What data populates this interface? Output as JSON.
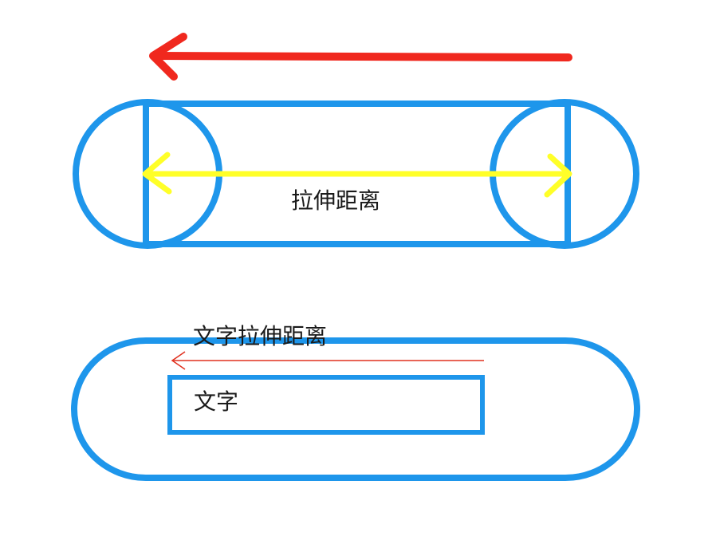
{
  "labels": {
    "stretch_distance": "拉伸距离",
    "text_stretch_distance": "文字拉伸距离",
    "text": "文字"
  },
  "colors": {
    "outline": "#1E96EB",
    "red_arrow": "#F0281E",
    "yellow_arrow": "#FFFF28",
    "thin_red_arrow": "#E0301E"
  }
}
